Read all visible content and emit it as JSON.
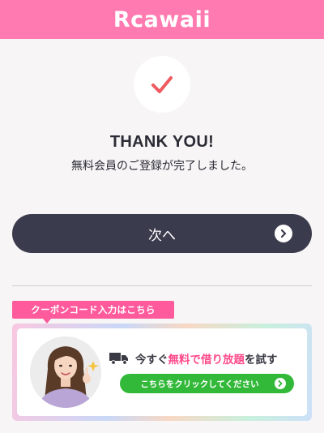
{
  "header": {
    "logo": "Rcawaii"
  },
  "success": {
    "title": "THANK YOU!",
    "message": "無料会員のご登録が完了しました。"
  },
  "next_button": {
    "label": "次へ"
  },
  "coupon": {
    "tag_label": "クーポンコード入力はこちら",
    "promo_parts": [
      "今すぐ",
      "無料で借り放題",
      "を試す"
    ],
    "click_label": "こちらをクリックしてください"
  },
  "colors": {
    "brand_pink": "#ff7ab0",
    "button_dark": "#3b3b4e",
    "check_red": "#ee5a5f",
    "tag_pink": "#ff5a9c",
    "highlight_pink": "#ff4b8b",
    "cta_green": "#33b93a"
  },
  "icons": {
    "check": "check-icon",
    "next_arrow": "chevron-right-circle-icon",
    "truck": "delivery-truck-icon",
    "cta_arrow": "chevron-right-circle-icon"
  }
}
